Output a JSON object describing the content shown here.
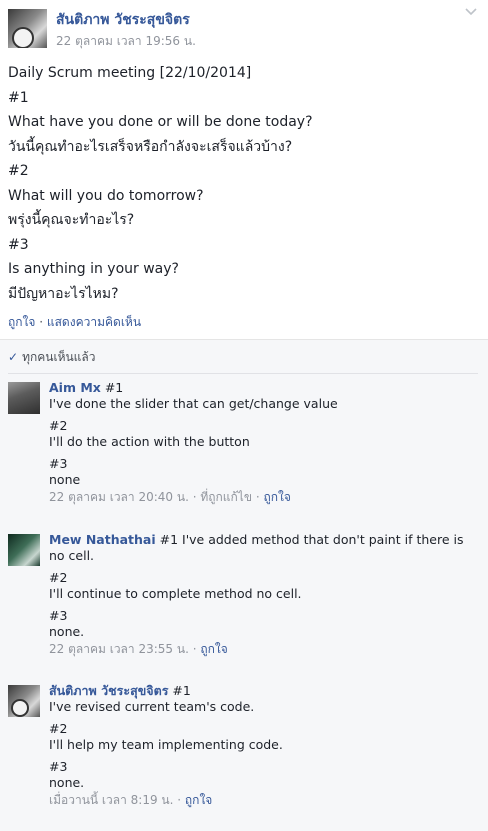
{
  "post": {
    "author": "สันติภาพ วัชระสุขจิตร",
    "timestamp": "22 ตุลาคม เวลา 19:56 น.",
    "body_lines": [
      "Daily Scrum meeting [22/10/2014]",
      "#1",
      "What have you done or will be done today?",
      "วันนี้คุณทำอะไรเสร็จหรือกำลังจะเสร็จแล้วบ้าง?",
      "#2",
      "What will you do tomorrow?",
      "พรุ่งนี้คุณจะทำอะไร?",
      "#3",
      "Is anything in your way?",
      "มีปัญหาอะไรไหม?"
    ],
    "actions": {
      "like": "ถูกใจ",
      "separator": " · ",
      "comment": "แสดงความคิดเห็น"
    }
  },
  "feedback": {
    "seen_label": "ทุกคนเห็นแล้ว",
    "comments": [
      {
        "author": "Aim Mx",
        "paragraphs": [
          [
            "#1",
            "I've done the slider that can get/change value"
          ],
          [
            "#2",
            "I'll do the action with the button"
          ],
          [
            "#3",
            "none"
          ]
        ],
        "timestamp": "22 ตุลาคม เวลา 20:40 น.",
        "edited": "ที่ถูกแก้ไข",
        "like": "ถูกใจ"
      },
      {
        "author": "Mew Nathathai",
        "paragraphs": [
          [
            "#1 I've added method that don't paint if there is",
            "no cell."
          ],
          [
            "#2",
            "I'll continue to complete method no cell."
          ],
          [
            "#3",
            "none."
          ]
        ],
        "timestamp": "22 ตุลาคม เวลา 23:55 น.",
        "like": "ถูกใจ"
      },
      {
        "author": "สันติภาพ วัชระสุขจิตร",
        "paragraphs": [
          [
            "#1",
            "I've revised current team's code."
          ],
          [
            "#2",
            "I'll help my team implementing code."
          ],
          [
            "#3",
            "none."
          ]
        ],
        "timestamp": "เมื่อวานนี้ เวลา 8:19 น.",
        "like": "ถูกใจ"
      }
    ]
  },
  "colors": {
    "link": "#365899",
    "meta": "#90949c",
    "text": "#1d2129",
    "feedback_bg": "#f6f7f9"
  },
  "icons": {
    "chevron": "chevron-down-icon",
    "check": "check-icon"
  }
}
